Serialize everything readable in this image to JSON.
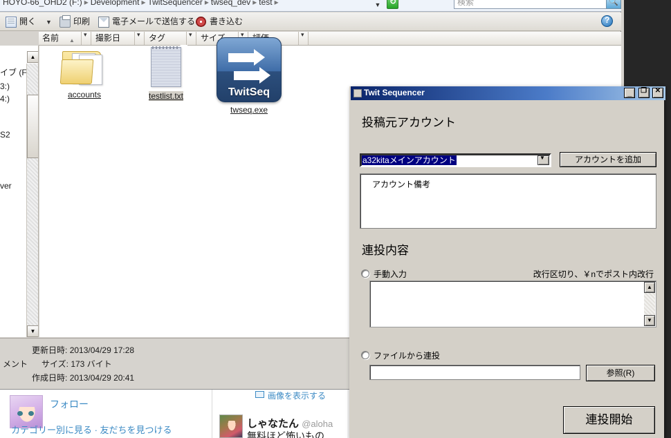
{
  "explorer": {
    "breadcrumb": [
      "HOYO-66_OHD2 (F:)",
      "Development",
      "TwitSequencer",
      "twseq_dev",
      "test"
    ],
    "address_dropdown_icon": "chevron-down-icon",
    "refresh_icon": "refresh-icon",
    "search": {
      "placeholder": "検索",
      "value": "",
      "button_icon": "search-icon"
    },
    "toolbar": {
      "open_label": "開く",
      "open_caret": "▼",
      "print_label": "印刷",
      "email_label": "電子メールで送信する",
      "burn_label": "書き込む",
      "help_icon": "help-icon"
    },
    "columns": [
      {
        "label": "名前",
        "sorted": "▲"
      },
      {
        "label": "撮影日",
        "sorted": ""
      },
      {
        "label": "タグ",
        "sorted": ""
      },
      {
        "label": "サイズ",
        "sorted": ""
      },
      {
        "label": "評価",
        "sorted": ""
      }
    ],
    "sidebar": {
      "chevron": "⌄",
      "lines": [
        "イブ (F:)",
        "3:)",
        "4:)",
        "S2",
        "ver"
      ]
    },
    "files": [
      {
        "name": "accounts",
        "icon": "folder-icon",
        "selected": false
      },
      {
        "name": "testlist.txt",
        "icon": "text-file-icon",
        "selected": true
      },
      {
        "name": "twseq.exe",
        "icon": "application-icon",
        "caption": "TwitSeq",
        "selected": false
      }
    ],
    "details": [
      {
        "label": "更新日時:",
        "value": "2013/04/29 17:28"
      },
      {
        "label": "サイズ:",
        "value": "173 バイト"
      },
      {
        "label": "作成日時:",
        "value": "2013/04/29 20:41"
      }
    ],
    "details_left_text": "メント"
  },
  "browser": {
    "follow_label": "フォロー",
    "category_links": "カテゴリー別に見る · 友だちを見つける",
    "show_image_label": "画像を表示する",
    "tweet": {
      "name": "しゃなたん",
      "handle": "@aloha",
      "text": "無料ほど怖いもの"
    }
  },
  "dialog": {
    "title": "Twit Sequencer",
    "window_buttons": {
      "minimize": "_",
      "maximize": "❐",
      "close": "✕"
    },
    "account_section_title": "投稿元アカウント",
    "account_combo": {
      "value": "a32kitaメインアカウント",
      "arrow": "▼"
    },
    "add_account_button": "アカウントを追加",
    "account_memo": "アカウント備考",
    "content_section_title": "連投内容",
    "manual_radio_label": "手動入力",
    "manual_hint": "改行区切り、￥nでポスト内改行",
    "manual_textarea": "",
    "file_radio_label": "ファイルから連投",
    "file_path_value": "",
    "browse_button": "参照(R)",
    "start_button": "連投開始",
    "scroll_up": "▲",
    "scroll_down": "▼"
  },
  "colors": {
    "titlebar_start": "#0a246a",
    "titlebar_end": "#a6c8e8",
    "dialog_face": "#d4d0c8",
    "selection": "#000080",
    "link": "#3b8ac4"
  }
}
